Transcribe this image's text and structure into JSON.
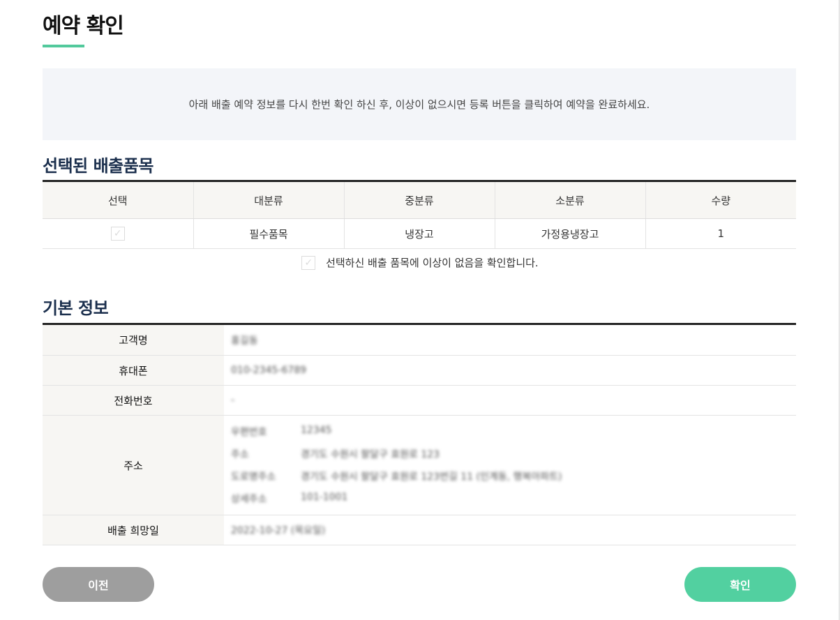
{
  "page": {
    "title": "예약 확인",
    "notice": "아래 배출 예약 정보를 다시 한번 확인 하신 후, 이상이 없으시면 등록 버튼을 클릭하여 예약을 완료하세요."
  },
  "items_section": {
    "title": "선택된 배출품목",
    "columns": [
      "선택",
      "대분류",
      "중분류",
      "소분류",
      "수량"
    ],
    "rows": [
      {
        "checked": true,
        "major": "필수품목",
        "middle": "냉장고",
        "minor": "가정용냉장고",
        "qty": "1"
      }
    ],
    "confirm_text": "선택하신 배출 품목에 이상이 없음을 확인합니다."
  },
  "info_section": {
    "title": "기본 정보",
    "fields": {
      "name_label": "고객명",
      "name_value": "홍길동",
      "mobile_label": "휴대폰",
      "mobile_value": "010-2345-6789",
      "phone_label": "전화번호",
      "phone_value": "-",
      "address_label": "주소",
      "address_lines": [
        {
          "key": "우편번호",
          "value": "12345"
        },
        {
          "key": "주소",
          "value": "경기도 수원시 팔달구 효원로 123"
        },
        {
          "key": "도로명주소",
          "value": "경기도 수원시 팔달구 효원로 123번길 11 (인계동, 행복아파트)"
        },
        {
          "key": "상세주소",
          "value": "101-1001"
        }
      ],
      "date_label": "배출 희망일",
      "date_value": "2022-10-27 (목요일)"
    }
  },
  "buttons": {
    "prev": "이전",
    "confirm": "확인"
  },
  "colors": {
    "accent": "#52d0a0",
    "prev_button": "#9e9e9e",
    "section_title": "#1b2f4d"
  }
}
